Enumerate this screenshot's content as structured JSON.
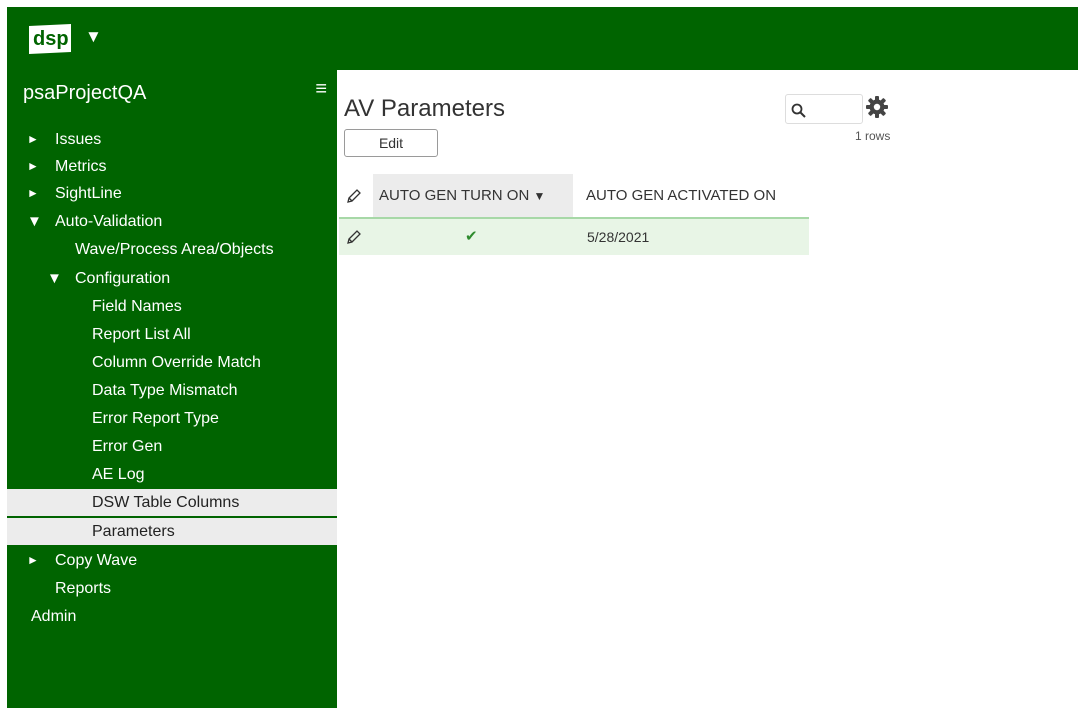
{
  "header": {
    "logo_text": "dsp",
    "logo_menu_icon": "caret-down-icon",
    "logo_caret": "▼"
  },
  "sidebar": {
    "project_title": "psaProjectQA",
    "menu_icon": "hamburger-icon",
    "menu_glyph": "≡",
    "items": [
      {
        "label": "Issues",
        "arrow": "►"
      },
      {
        "label": "Metrics",
        "arrow": "►"
      },
      {
        "label": "SightLine",
        "arrow": "►"
      },
      {
        "label": "Auto-Validation",
        "arrow": "▼"
      },
      {
        "label": "Wave/Process Area/Objects",
        "arrow": ""
      },
      {
        "label": "Configuration",
        "arrow": "▼"
      },
      {
        "label": "Field Names",
        "arrow": ""
      },
      {
        "label": "Report List All",
        "arrow": ""
      },
      {
        "label": "Column Override Match",
        "arrow": ""
      },
      {
        "label": "Data Type Mismatch",
        "arrow": ""
      },
      {
        "label": "Error Report Type",
        "arrow": ""
      },
      {
        "label": "Error Gen",
        "arrow": ""
      },
      {
        "label": "AE Log",
        "arrow": ""
      },
      {
        "label": "DSW Table Columns",
        "arrow": ""
      },
      {
        "label": "Parameters",
        "arrow": ""
      },
      {
        "label": "Copy Wave",
        "arrow": "►"
      },
      {
        "label": "Reports",
        "arrow": ""
      },
      {
        "label": "Admin",
        "arrow": ""
      }
    ]
  },
  "main": {
    "title": "AV Parameters",
    "edit_label": "Edit",
    "row_count": "1 rows",
    "search_icon": "search-icon",
    "settings_icon": "gear-icon"
  },
  "table": {
    "columns": [
      "AUTO GEN TURN ON",
      "AUTO GEN ACTIVATED ON"
    ],
    "sort_indicator": "▼",
    "rows": [
      {
        "auto_gen_turn_on": "✔",
        "auto_gen_activated_on": "5/28/2021"
      }
    ]
  },
  "colors": {
    "brand_green": "#006400",
    "row_highlight": "#e8f5e6",
    "selected_nav": "#ececec",
    "check_green": "#2e8b2e"
  }
}
